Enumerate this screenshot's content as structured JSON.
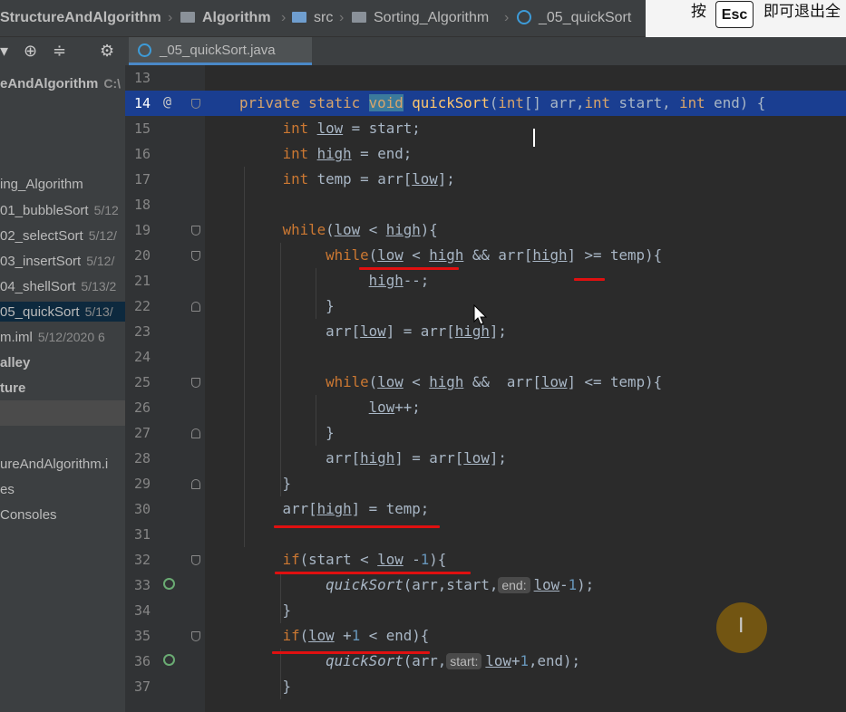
{
  "breadcrumbs": [
    "StructureAndAlgorithm",
    "Algorithm",
    "src",
    "Sorting_Algorithm",
    "_05_quickSort"
  ],
  "overlay": {
    "press": "按",
    "key": "Esc",
    "message": "即可退出全"
  },
  "project": {
    "root_name": "eAndAlgorithm",
    "root_path": "C:\\",
    "items": [
      {
        "label": "ing_Algorithm",
        "meta": ""
      },
      {
        "label": "01_bubbleSort",
        "meta": "5/12"
      },
      {
        "label": "02_selectSort",
        "meta": "5/12/"
      },
      {
        "label": "03_insertSort",
        "meta": "5/12/"
      },
      {
        "label": "04_shellSort",
        "meta": "5/13/2"
      },
      {
        "label": "05_quickSort",
        "meta": "5/13/"
      },
      {
        "label": "m.iml",
        "meta": "5/12/2020 6"
      },
      {
        "label": "alley",
        "meta": ""
      },
      {
        "label": "ture",
        "meta": ""
      },
      {
        "label": "ureAndAlgorithm.i",
        "meta": ""
      },
      {
        "label": "es",
        "meta": ""
      },
      {
        "label": "Consoles",
        "meta": ""
      }
    ]
  },
  "editor": {
    "tab_label": "_05_quickSort.java",
    "line_numbers": [
      "13",
      "14",
      "15",
      "16",
      "17",
      "18",
      "19",
      "20",
      "21",
      "22",
      "23",
      "24",
      "25",
      "26",
      "27",
      "28",
      "29",
      "30",
      "31",
      "32",
      "33",
      "34",
      "35",
      "36",
      "37"
    ],
    "hints": {
      "end": "end:",
      "start": "start:"
    },
    "current_line": "14"
  },
  "colors": {
    "keyword": "#cc7832",
    "function": "#ffc66d",
    "number": "#6897bb",
    "text": "#a9b7c6",
    "current_line": "#1a3e91",
    "annotation_red": "#e01010"
  }
}
